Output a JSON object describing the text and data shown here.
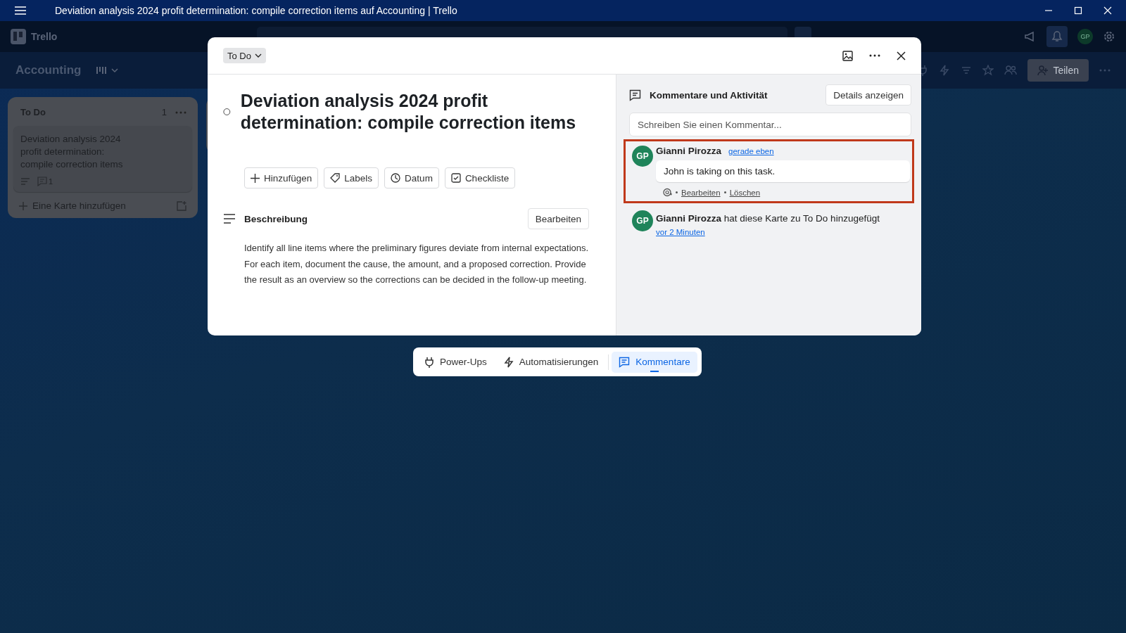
{
  "window": {
    "title": "Deviation analysis 2024 profit determination: compile correction items auf Accounting | Trello"
  },
  "topbar": {
    "logo": "Trello",
    "avatar": "GP"
  },
  "board": {
    "name": "Accounting",
    "share_button": "Teilen"
  },
  "list": {
    "title": "To Do",
    "count": "1",
    "card": {
      "title": "Deviation analysis 2024 profit determination: compile correction items",
      "comment_count": "1"
    },
    "add_card": "Eine Karte hinzufügen"
  },
  "modal": {
    "list_button": "To Do",
    "title": "Deviation analysis 2024 profit determination: compile correction items",
    "completed": false,
    "actions": [
      {
        "kind": "plus",
        "label": "Hinzufügen"
      },
      {
        "kind": "tag",
        "label": "Labels"
      },
      {
        "kind": "clock",
        "label": "Datum"
      },
      {
        "kind": "check",
        "label": "Checkliste"
      }
    ],
    "description": {
      "heading": "Beschreibung",
      "edit_button": "Bearbeiten",
      "text": "Identify all line items where the preliminary figures deviate from internal expectations. For each item, document the cause, the amount, and a proposed correction. Provide the result as an overview so the corrections can be decided in the follow-up meeting."
    },
    "activity_panel": {
      "heading": "Kommentare und Aktivität",
      "details_button": "Details anzeigen",
      "comment_placeholder": "Schreiben Sie einen Kommentar...",
      "items": [
        {
          "kind": "comment",
          "avatar": "GP",
          "author": "Gianni Pirozza",
          "time": "gerade eben",
          "text": "John is taking on this task.",
          "actions": [
            "Bearbeiten",
            "Löschen"
          ],
          "highlighted": true
        },
        {
          "kind": "event",
          "avatar": "GP",
          "author": "Gianni Pirozza",
          "text": "hat diese Karte zu To Do hinzugefügt",
          "time": "vor 2 Minuten",
          "highlighted": false
        }
      ]
    }
  },
  "bottom_bar": {
    "tabs": [
      {
        "kind": "plug",
        "label": "Power-Ups",
        "selected": false
      },
      {
        "kind": "bolt",
        "label": "Automatisierungen",
        "selected": false
      },
      {
        "kind": "comment",
        "label": "Kommentare",
        "selected": true
      }
    ]
  }
}
